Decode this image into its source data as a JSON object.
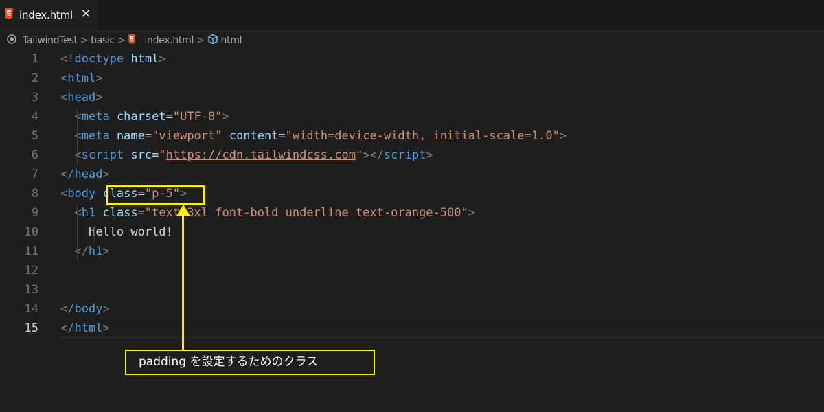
{
  "tab": {
    "label": "index.html",
    "close": "✕"
  },
  "breadcrumb": {
    "items": [
      "TailwindTest",
      "basic",
      "index.html",
      "html"
    ],
    "separator": ">"
  },
  "editor": {
    "active_line": 15,
    "lines": [
      {
        "n": "1",
        "segments": [
          [
            "br",
            "<!"
          ],
          [
            "tag",
            "doctype"
          ],
          [
            "eq",
            " "
          ],
          [
            "attr",
            "html"
          ],
          [
            "br",
            ">"
          ]
        ]
      },
      {
        "n": "2",
        "segments": [
          [
            "br",
            "<"
          ],
          [
            "tag",
            "html"
          ],
          [
            "br",
            ">"
          ]
        ]
      },
      {
        "n": "3",
        "segments": [
          [
            "br",
            "<"
          ],
          [
            "tag",
            "head"
          ],
          [
            "br",
            ">"
          ]
        ]
      },
      {
        "n": "4",
        "segments": [
          [
            "eq",
            "  "
          ],
          [
            "br",
            "<"
          ],
          [
            "tag",
            "meta"
          ],
          [
            "eq",
            " "
          ],
          [
            "attr",
            "charset"
          ],
          [
            "eq",
            "="
          ],
          [
            "str",
            "\"UTF-8\""
          ],
          [
            "br",
            ">"
          ]
        ]
      },
      {
        "n": "5",
        "segments": [
          [
            "eq",
            "  "
          ],
          [
            "br",
            "<"
          ],
          [
            "tag",
            "meta"
          ],
          [
            "eq",
            " "
          ],
          [
            "attr",
            "name"
          ],
          [
            "eq",
            "="
          ],
          [
            "str",
            "\"viewport\""
          ],
          [
            "eq",
            " "
          ],
          [
            "attr",
            "content"
          ],
          [
            "eq",
            "="
          ],
          [
            "str",
            "\"width=device-width, initial-scale=1.0\""
          ],
          [
            "br",
            ">"
          ]
        ]
      },
      {
        "n": "6",
        "segments": [
          [
            "eq",
            "  "
          ],
          [
            "br",
            "<"
          ],
          [
            "tag",
            "script"
          ],
          [
            "eq",
            " "
          ],
          [
            "attr",
            "src"
          ],
          [
            "eq",
            "="
          ],
          [
            "str",
            "\""
          ],
          [
            "url",
            "https://cdn.tailwindcss.com"
          ],
          [
            "str",
            "\""
          ],
          [
            "br",
            "></"
          ],
          [
            "tag",
            "script"
          ],
          [
            "br",
            ">"
          ]
        ]
      },
      {
        "n": "7",
        "segments": [
          [
            "br",
            "</"
          ],
          [
            "tag",
            "head"
          ],
          [
            "br",
            ">"
          ]
        ]
      },
      {
        "n": "8",
        "segments": [
          [
            "br",
            "<"
          ],
          [
            "tag",
            "body"
          ],
          [
            "eq",
            " "
          ],
          [
            "attr",
            "class"
          ],
          [
            "eq",
            "="
          ],
          [
            "str",
            "\"p-5\""
          ],
          [
            "br",
            ">"
          ]
        ]
      },
      {
        "n": "9",
        "segments": [
          [
            "eq",
            "  "
          ],
          [
            "br",
            "<"
          ],
          [
            "tag",
            "h1"
          ],
          [
            "eq",
            " "
          ],
          [
            "attr",
            "class"
          ],
          [
            "eq",
            "="
          ],
          [
            "str",
            "\"text-3xl font-bold underline text-orange-500\""
          ],
          [
            "br",
            ">"
          ]
        ]
      },
      {
        "n": "10",
        "segments": [
          [
            "eq",
            "    "
          ],
          [
            "text",
            "Hello world!"
          ]
        ]
      },
      {
        "n": "11",
        "segments": [
          [
            "eq",
            "  "
          ],
          [
            "br",
            "</"
          ],
          [
            "tag",
            "h1"
          ],
          [
            "br",
            ">"
          ]
        ]
      },
      {
        "n": "12",
        "segments": []
      },
      {
        "n": "13",
        "segments": []
      },
      {
        "n": "14",
        "segments": [
          [
            "br",
            "</"
          ],
          [
            "tag",
            "body"
          ],
          [
            "br",
            ">"
          ]
        ]
      },
      {
        "n": "15",
        "segments": [
          [
            "br",
            "</"
          ],
          [
            "tag",
            "html"
          ],
          [
            "br",
            ">"
          ]
        ]
      }
    ]
  },
  "annotation": {
    "text": "padding を設定するためのクラス",
    "color": "#fff200"
  },
  "colors": {
    "tag": "#569cd6",
    "attribute": "#9cdcfe",
    "string": "#ce9178",
    "bracket": "#808080",
    "html5_icon": "#e44d26"
  }
}
